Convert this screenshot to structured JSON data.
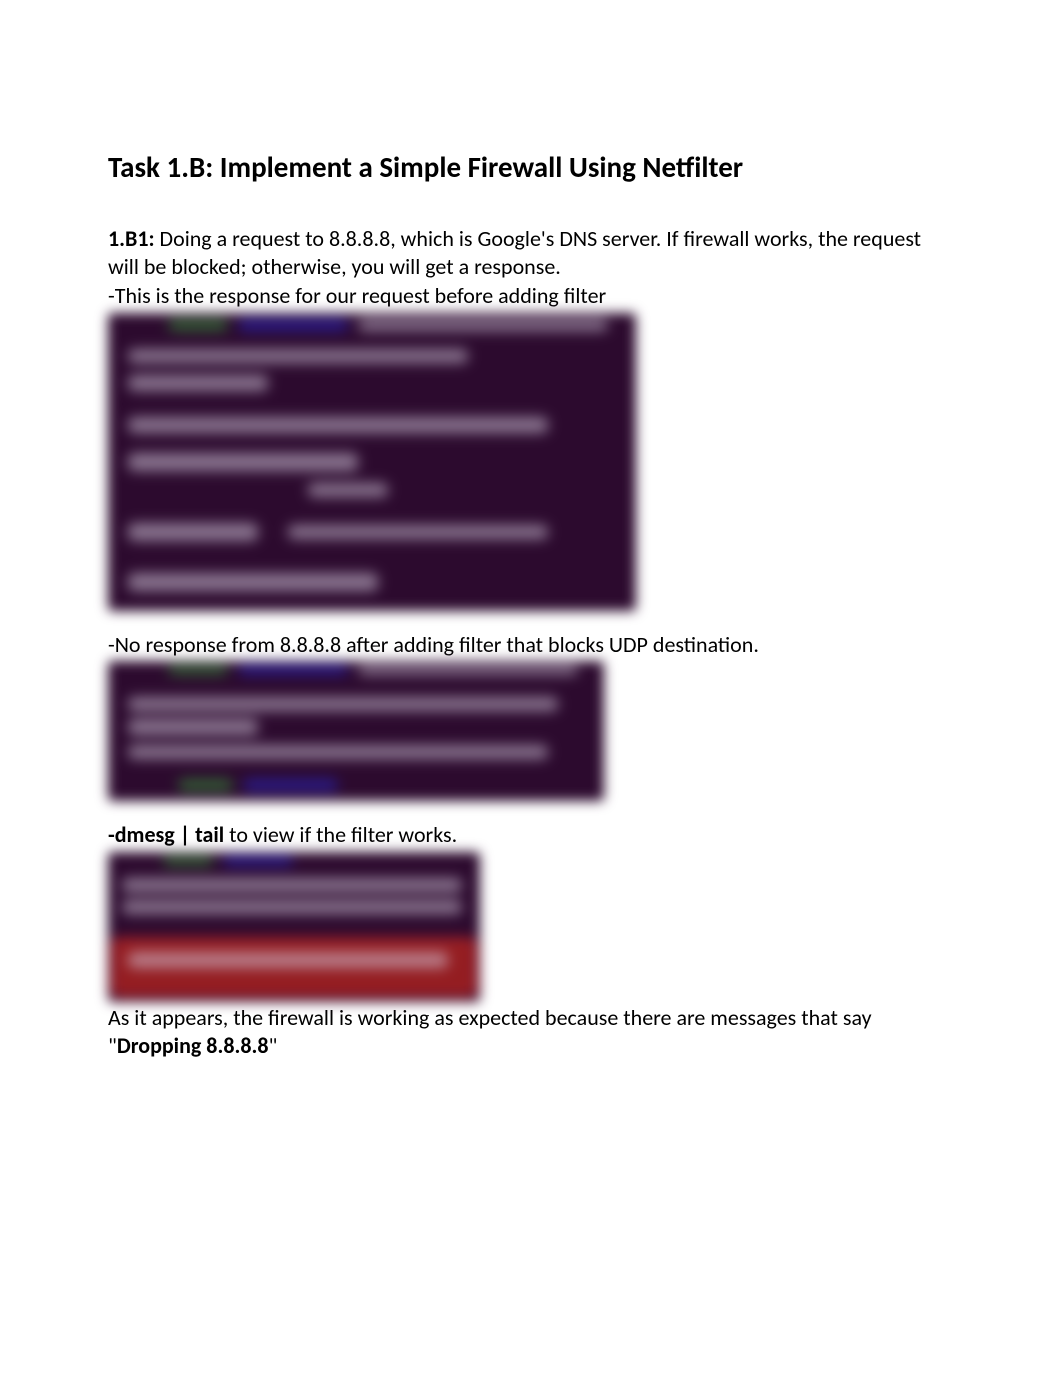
{
  "title": "Task 1.B: Implement a Simple Firewall Using Netfilter",
  "section1": {
    "label": "1.B1:",
    "body": " Doing a request to 8.8.8.8, which is Google's DNS server. If firewall works, the request will be blocked; otherwise, you will get a response.",
    "note": "-This is the response for our request before adding filter"
  },
  "section2": {
    "body": "-No response from 8.8.8.8 after adding filter that blocks UDP destination."
  },
  "section3": {
    "cmd": "-dmesg | tail",
    "tail": " to view if the filter works."
  },
  "section4": {
    "pre": "As it appears, the firewall is working as expected because there are messages that say \"",
    "bold": "Dropping 8.8.8.8",
    "post": "\""
  }
}
